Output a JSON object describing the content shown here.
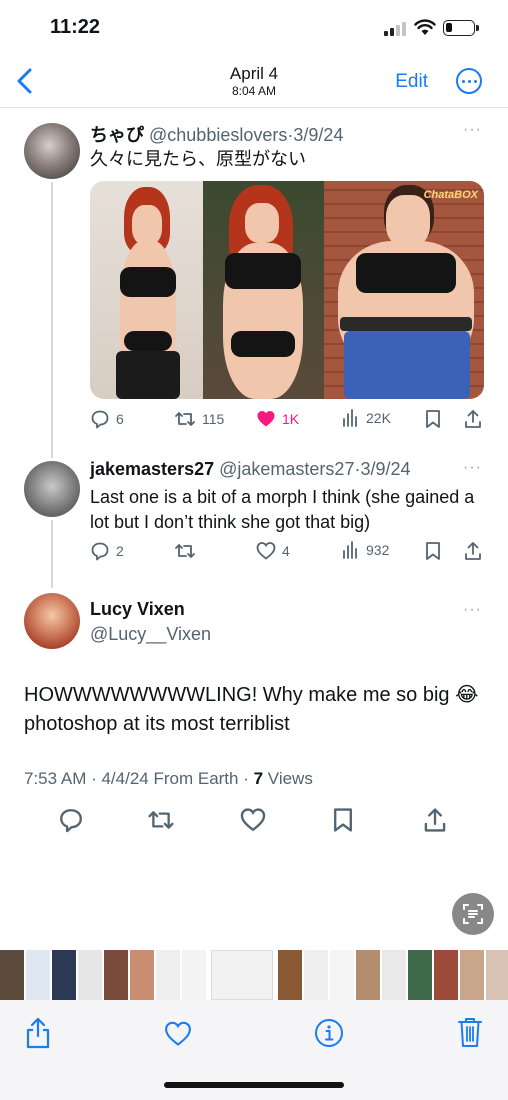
{
  "status_bar": {
    "time": "11:22"
  },
  "photos_nav": {
    "date": "April 4",
    "time": "8:04 AM",
    "edit_label": "Edit"
  },
  "thread": [
    {
      "name": "ちゃぴ",
      "handle": "@chubbieslovers",
      "date": "3/9/24",
      "text": "久々に見たら、原型がない",
      "media_watermark": "ChataBOX",
      "replies": "6",
      "reposts": "115",
      "likes": "1K",
      "views": "22K"
    },
    {
      "name": "jakemasters27",
      "handle": "@jakemasters27",
      "date": "3/9/24",
      "text": "Last one is a bit of a morph I think (she gained a lot but I don’t think she got that big)",
      "replies": "2",
      "reposts": "",
      "likes": "4",
      "views": "932"
    }
  ],
  "main_post": {
    "name": "Lucy Vixen",
    "handle": "@Lucy__Vixen",
    "text": "HOWWWWWWWWLING! Why make me so big 😂 photoshop at its most terriblist",
    "meta_time": "7:53 AM · 4/4/24 From Earth · ",
    "views_count": "7",
    "views_label": " Views"
  },
  "colors": {
    "accent": "#1a7cf5",
    "like": "#f91880",
    "secondary": "#536471"
  },
  "icons": [
    "back-chevron-icon",
    "more-icon",
    "reply-icon",
    "repost-icon",
    "heart-icon",
    "views-icon",
    "bookmark-icon",
    "share-icon",
    "live-text-icon",
    "trash-icon",
    "info-icon"
  ]
}
